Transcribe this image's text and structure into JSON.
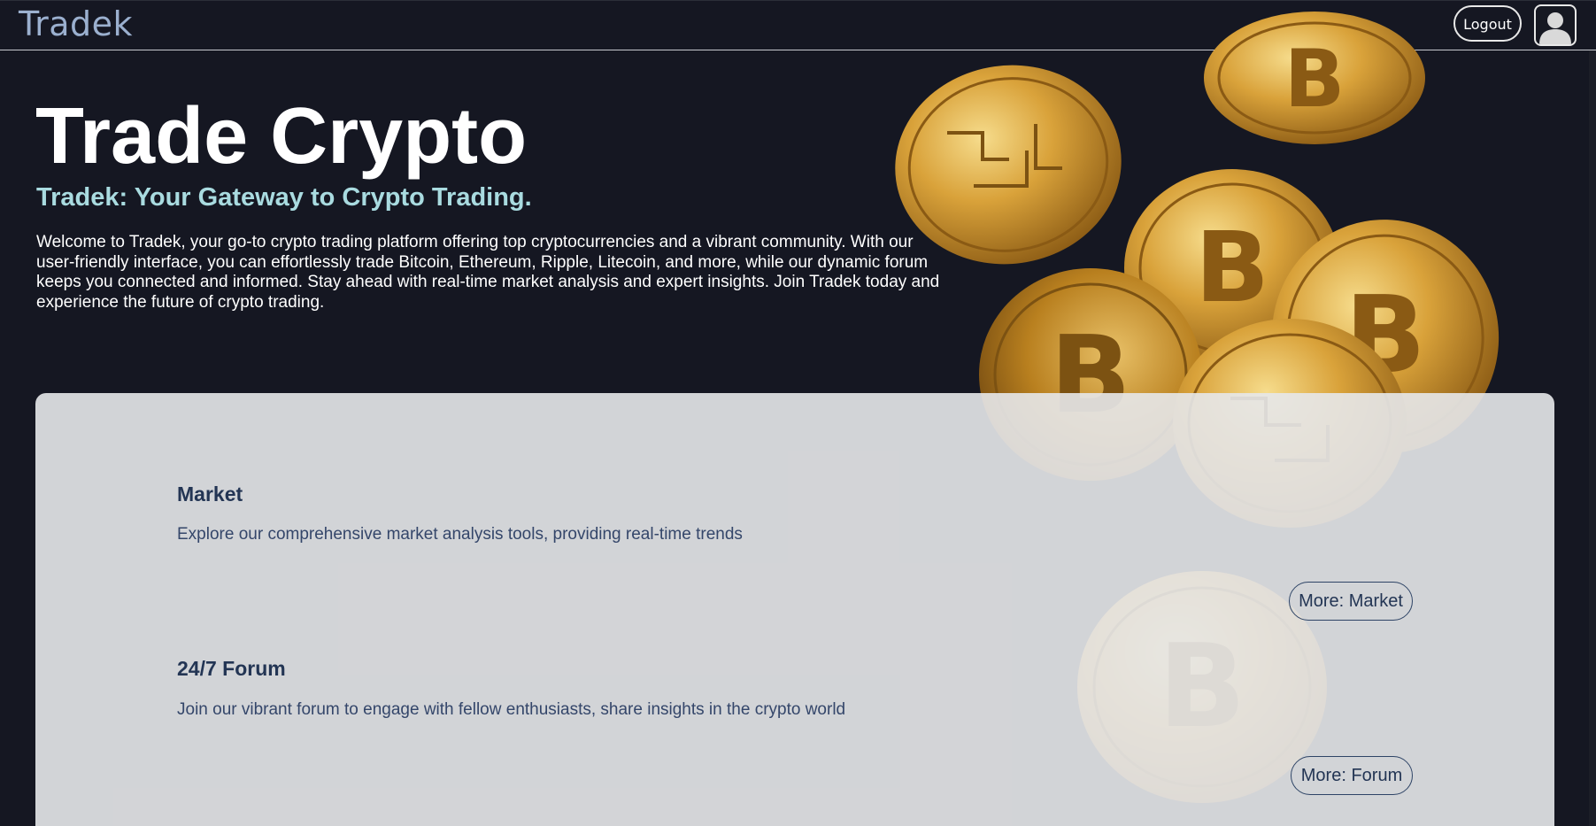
{
  "navbar": {
    "brand": "Tradek",
    "logout_label": "Logout",
    "avatar_icon": "user-avatar-icon"
  },
  "hero": {
    "title": "Trade Crypto",
    "subtitle": "Tradek: Your Gateway to Crypto Trading.",
    "description": "Welcome to Tradek, your go-to crypto trading platform offering top cryptocurrencies and a vibrant community. With our user-friendly interface, you can effortlessly trade Bitcoin, Ethereum, Ripple, Litecoin, and more, while our dynamic forum keeps you connected and informed. Stay ahead with real-time market analysis and expert insights. Join Tradek today and experience the future of crypto trading."
  },
  "features": [
    {
      "title": "Market",
      "text": "Explore our comprehensive market analysis tools, providing real-time trends",
      "button_label": "More: Market"
    },
    {
      "title": "24/7 Forum",
      "text": "Join our vibrant forum to engage with fellow enthusiasts, share insights in the crypto world",
      "button_label": "More: Forum"
    }
  ],
  "colors": {
    "background": "#151722",
    "brand_text": "#9bb0cf",
    "subtitle_text": "#a9dbe0",
    "card_background": "#e6e7e9",
    "feature_title": "#233554",
    "coin_gold": "#d9a23a"
  }
}
